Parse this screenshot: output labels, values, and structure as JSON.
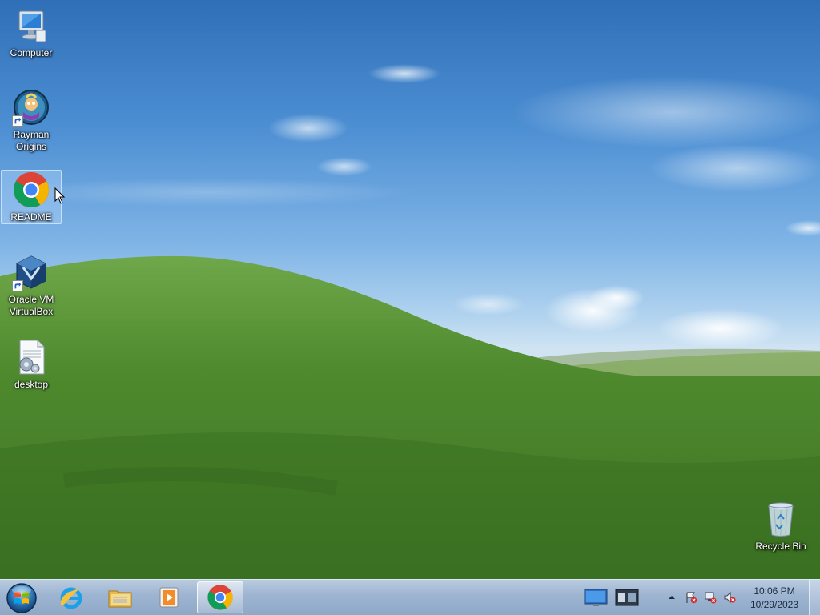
{
  "desktop": {
    "icons": [
      {
        "label": "Computer",
        "icon": "computer-icon"
      },
      {
        "label": "Rayman Origins",
        "icon": "rayman-icon",
        "shortcut": true
      },
      {
        "label": "README",
        "icon": "chrome-icon",
        "selected": true
      },
      {
        "label": "Oracle VM VirtualBox",
        "icon": "virtualbox-icon",
        "shortcut": true
      },
      {
        "label": "desktop",
        "icon": "settings-file-icon"
      }
    ],
    "recycle_bin": {
      "label": "Recycle Bin",
      "icon": "recycle-bin-icon"
    }
  },
  "taskbar": {
    "start": {
      "icon": "windows-start-icon"
    },
    "pinned": [
      {
        "name": "internet-explorer",
        "icon": "ie-icon"
      },
      {
        "name": "file-explorer",
        "icon": "folder-icon"
      },
      {
        "name": "media-player",
        "icon": "media-player-icon"
      },
      {
        "name": "google-chrome",
        "icon": "chrome-icon",
        "active": true
      }
    ],
    "tray": {
      "icons": [
        "display-icon",
        "virtual-desktop-icon",
        "show-hidden-icons-arrow",
        "flag-error-icon",
        "network-error-icon",
        "volume-muted-icon"
      ],
      "time": "10:06 PM",
      "date": "10/29/2023"
    }
  },
  "colors": {
    "sky_top": "#2f6fb8",
    "grass": "#4f8a2e",
    "taskbar": "#9fb6d2"
  }
}
